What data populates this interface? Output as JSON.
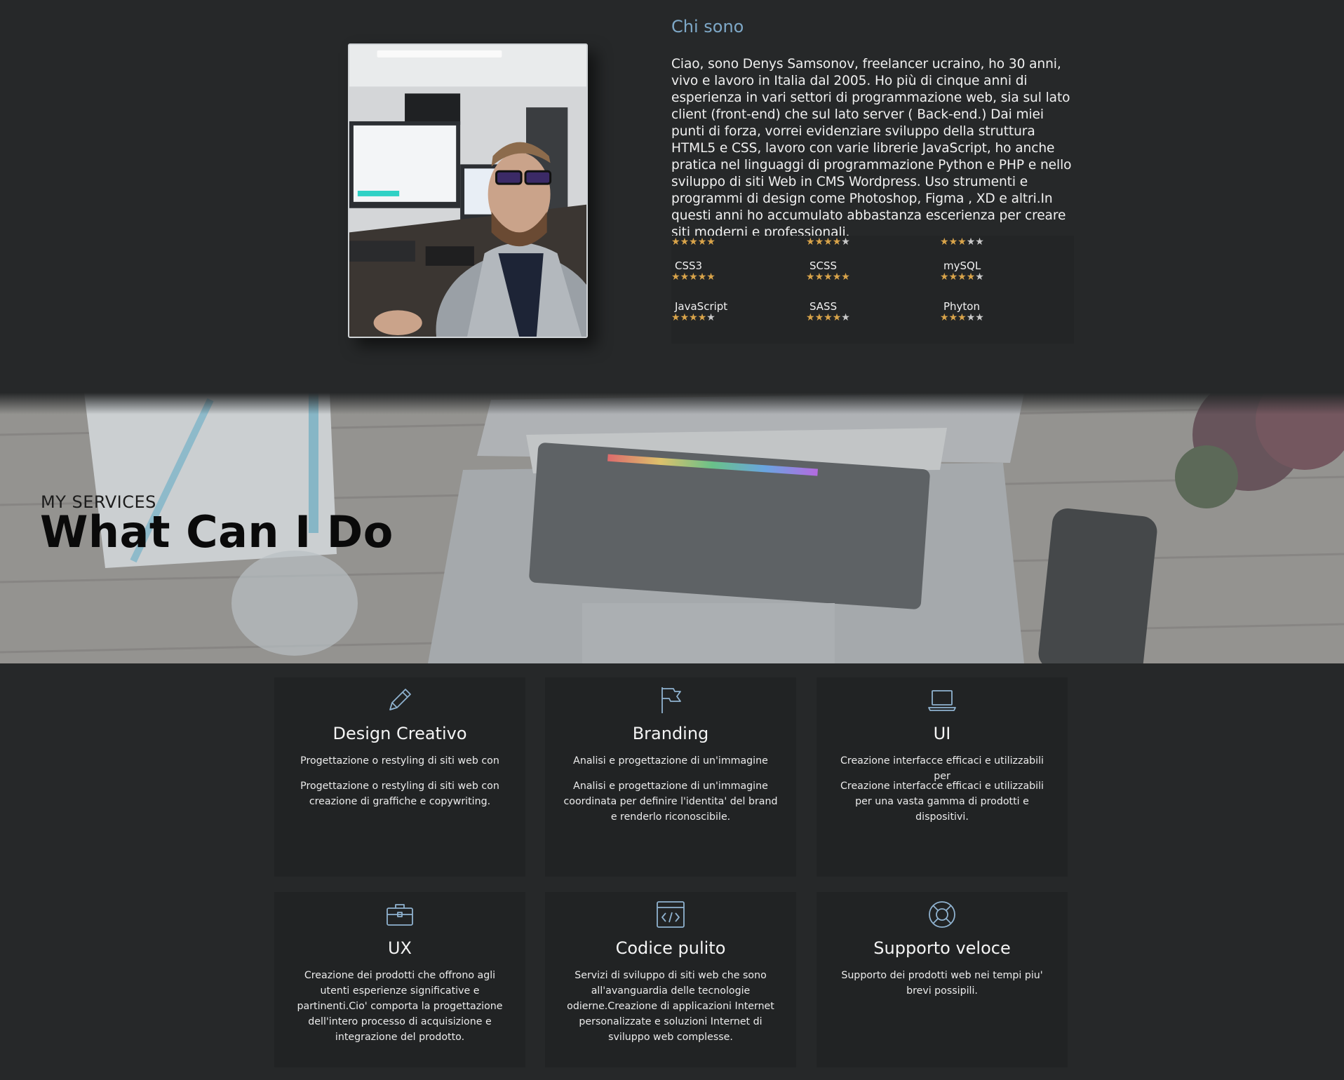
{
  "about": {
    "title": "Chi sono",
    "text": "Ciao, sono Denys Samsonov, freelancer ucraino, ho 30 anni, vivo e lavoro in Italia dal 2005. Ho più di cinque anni di esperienza in vari settori di programmazione web, sia sul lato client (front-end) che sul lato server ( Back-end.) Dai miei punti di forza, vorrei evidenziare sviluppo della struttura HTML5 e CSS, lavoro con varie librerie JavaScript, ho anche pratica nel linguaggi di programmazione Python e PHP e nello sviluppo di siti Web in CMS Wordpress. Uso strumenti e programmi di design come Photoshop, Figma , XD e altri.In questi anni ho accumulato abbastanza escerienza per creare siti moderni e professionali.",
    "photo_alt": "photo of developer at desk"
  },
  "skills": [
    {
      "name": "",
      "rating": 5
    },
    {
      "name": "",
      "rating": 4
    },
    {
      "name": "",
      "rating": 3
    },
    {
      "name": "CSS3",
      "rating": 5
    },
    {
      "name": "SCSS",
      "rating": 5
    },
    {
      "name": "mySQL",
      "rating": 4
    },
    {
      "name": "JavaScript",
      "rating": 4
    },
    {
      "name": "SASS",
      "rating": 4
    },
    {
      "name": "Phyton",
      "rating": 3
    }
  ],
  "colors": {
    "accent": "#7ea8c7",
    "star": "#d9a44a",
    "background": "#262829",
    "card": "#212324"
  },
  "hero": {
    "subtitle": "MY SERVICES",
    "title": "What Can I Do"
  },
  "services": [
    {
      "icon": "pencil-icon",
      "title": "Design Creativo",
      "short": "Progettazione o restyling di siti web con",
      "text": "Progettazione o restyling di siti web con creazione di graffiche e copywriting."
    },
    {
      "icon": "flag-icon",
      "title": "Branding",
      "short": "Analisi e progettazione di un'immagine",
      "text": "Analisi e progettazione di un'immagine coordinata per definire l'identita' del brand e renderlo riconoscibile."
    },
    {
      "icon": "laptop-icon",
      "title": "UI",
      "short": "Creazione interfacce efficaci e utilizzabili per",
      "text": "Creazione interfacce efficaci e utilizzabili per una vasta gamma di prodotti e dispositivi."
    },
    {
      "icon": "briefcase-icon",
      "title": "UX",
      "short": "",
      "text": "Creazione dei prodotti che offrono agli utenti esperienze significative e partinenti.Cio' comporta la progettazione dell'intero processo di acquisizione e integrazione del prodotto."
    },
    {
      "icon": "code-window-icon",
      "title": "Codice pulito",
      "short": "",
      "text": "Servizi di sviluppo di siti web che sono all'avanguardia delle tecnologie odierne.Creazione di applicazioni Internet personalizzate e soluzioni Internet di sviluppo web complesse."
    },
    {
      "icon": "lifebuoy-icon",
      "title": "Supporto veloce",
      "short": "",
      "text": "Supporto dei prodotti web nei tempi piu' brevi possipili."
    }
  ]
}
